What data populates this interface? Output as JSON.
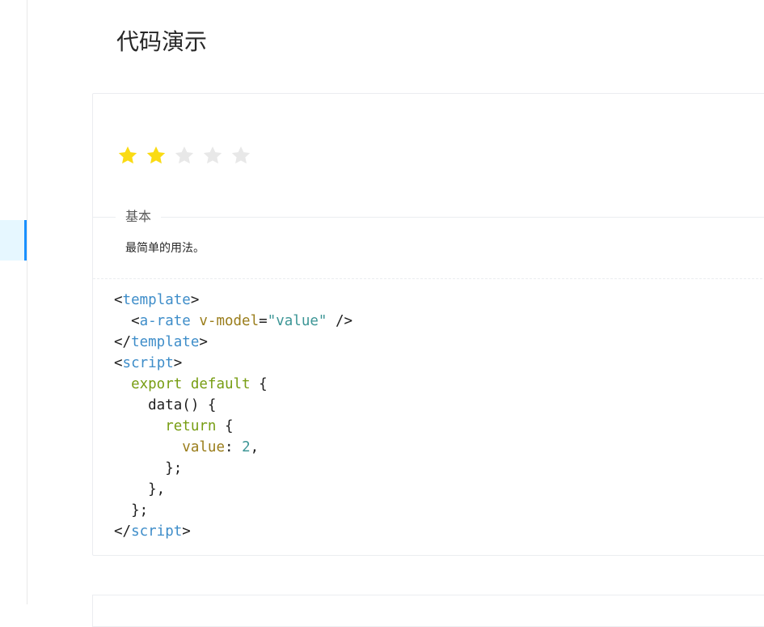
{
  "page": {
    "title": "代码演示"
  },
  "demo": {
    "rate": {
      "value": 2,
      "count": 5,
      "active_color": "#fadb14",
      "inactive_color": "#e8e8e8"
    },
    "meta_title": "基本",
    "meta_description": "最简单的用法。"
  },
  "code": {
    "lines": [
      [
        {
          "t": "<",
          "c": "plain"
        },
        {
          "t": "template",
          "c": "tag"
        },
        {
          "t": ">",
          "c": "plain"
        }
      ],
      [
        {
          "t": "  <",
          "c": "plain"
        },
        {
          "t": "a-rate",
          "c": "tag"
        },
        {
          "t": " ",
          "c": "plain"
        },
        {
          "t": "v-model",
          "c": "attr"
        },
        {
          "t": "=",
          "c": "plain"
        },
        {
          "t": "\"value\"",
          "c": "str"
        },
        {
          "t": " />",
          "c": "plain"
        }
      ],
      [
        {
          "t": "</",
          "c": "plain"
        },
        {
          "t": "template",
          "c": "tag"
        },
        {
          "t": ">",
          "c": "plain"
        }
      ],
      [
        {
          "t": "<",
          "c": "plain"
        },
        {
          "t": "script",
          "c": "tag"
        },
        {
          "t": ">",
          "c": "plain"
        }
      ],
      [
        {
          "t": "  ",
          "c": "plain"
        },
        {
          "t": "export",
          "c": "kw"
        },
        {
          "t": " ",
          "c": "plain"
        },
        {
          "t": "default",
          "c": "kw"
        },
        {
          "t": " {",
          "c": "plain"
        }
      ],
      [
        {
          "t": "    data() {",
          "c": "plain"
        }
      ],
      [
        {
          "t": "      ",
          "c": "plain"
        },
        {
          "t": "return",
          "c": "kw"
        },
        {
          "t": " {",
          "c": "plain"
        }
      ],
      [
        {
          "t": "        ",
          "c": "plain"
        },
        {
          "t": "value",
          "c": "attr"
        },
        {
          "t": ": ",
          "c": "plain"
        },
        {
          "t": "2",
          "c": "num"
        },
        {
          "t": ",",
          "c": "plain"
        }
      ],
      [
        {
          "t": "      };",
          "c": "plain"
        }
      ],
      [
        {
          "t": "    },",
          "c": "plain"
        }
      ],
      [
        {
          "t": "  };",
          "c": "plain"
        }
      ],
      [
        {
          "t": "</",
          "c": "plain"
        },
        {
          "t": "script",
          "c": "tag"
        },
        {
          "t": ">",
          "c": "plain"
        }
      ]
    ]
  }
}
